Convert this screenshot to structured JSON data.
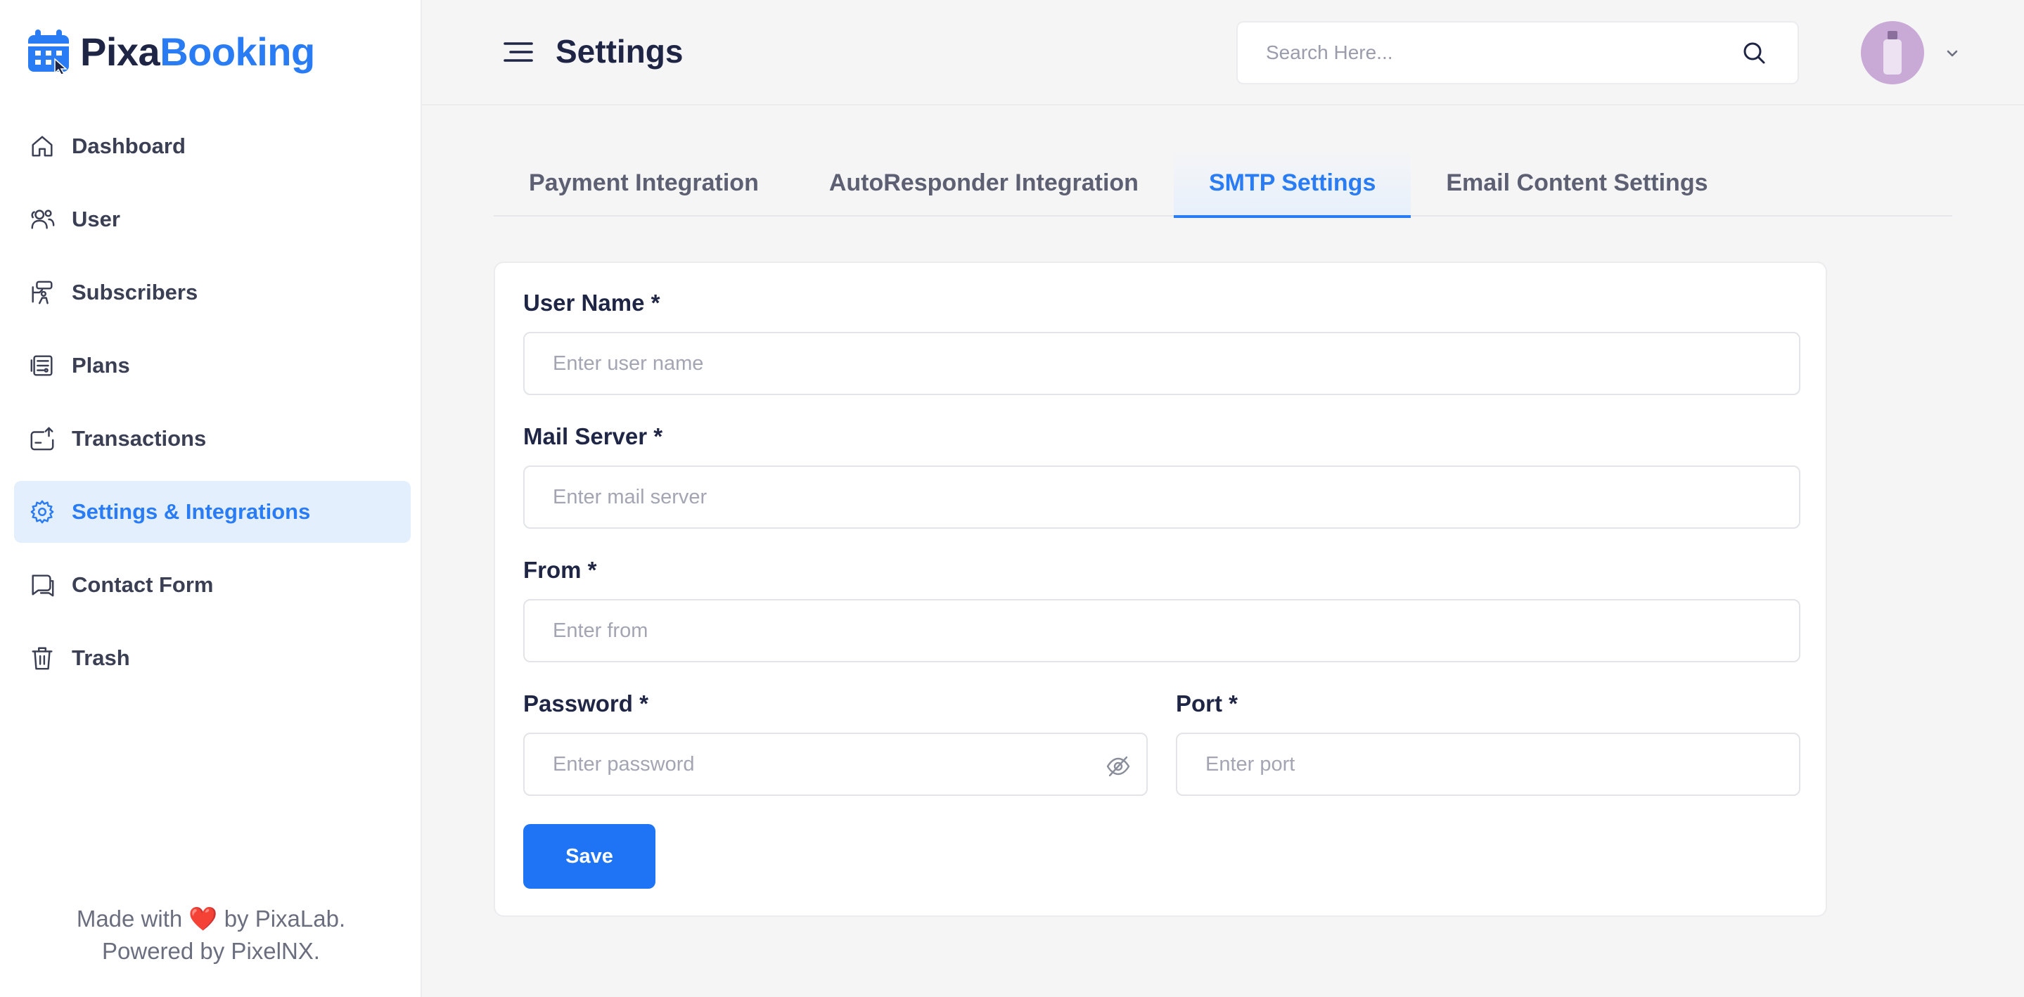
{
  "brand": {
    "name_part1": "Pixa",
    "name_part2": "Booking",
    "accent": "#2a7cf4"
  },
  "sidebar": {
    "items": [
      {
        "label": "Dashboard",
        "icon": "home-icon",
        "active": false
      },
      {
        "label": "User",
        "icon": "users-icon",
        "active": false
      },
      {
        "label": "Subscribers",
        "icon": "subscribers-icon",
        "active": false
      },
      {
        "label": "Plans",
        "icon": "plans-icon",
        "active": false
      },
      {
        "label": "Transactions",
        "icon": "transactions-icon",
        "active": false
      },
      {
        "label": "Settings & Integrations",
        "icon": "gear-icon",
        "active": true
      },
      {
        "label": "Contact Form",
        "icon": "chat-icon",
        "active": false
      },
      {
        "label": "Trash",
        "icon": "trash-icon",
        "active": false
      }
    ],
    "footer": {
      "line1_prefix": "Made with",
      "heart": "❤️",
      "line1_suffix": "by PixaLab.",
      "line2": "Powered by PixelNX."
    }
  },
  "header": {
    "title": "Settings",
    "search_placeholder": "Search Here..."
  },
  "tabs": [
    {
      "label": "Payment Integration",
      "active": false
    },
    {
      "label": "AutoResponder Integration",
      "active": false
    },
    {
      "label": "SMTP Settings",
      "active": true
    },
    {
      "label": "Email Content Settings",
      "active": false
    }
  ],
  "form": {
    "username": {
      "label": "User Name *",
      "placeholder": "Enter user name",
      "value": ""
    },
    "mail_server": {
      "label": "Mail Server *",
      "placeholder": "Enter mail server",
      "value": ""
    },
    "from": {
      "label": "From *",
      "placeholder": "Enter from",
      "value": ""
    },
    "password": {
      "label": "Password *",
      "placeholder": "Enter password",
      "value": ""
    },
    "port": {
      "label": "Port *",
      "placeholder": "Enter port",
      "value": ""
    },
    "save_label": "Save"
  }
}
